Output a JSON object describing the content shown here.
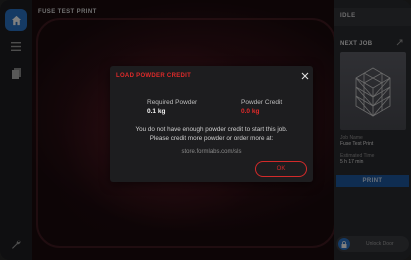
{
  "colors": {
    "accent": "#2a74c9",
    "error": "#e02a2a",
    "ok_border": "#d22a2a"
  },
  "sidebar": {
    "items": [
      {
        "icon": "home-icon",
        "active": true
      },
      {
        "icon": "menu-icon",
        "active": false
      },
      {
        "icon": "document-icon",
        "active": false
      },
      {
        "icon": "wrench-icon",
        "active": false
      }
    ]
  },
  "main": {
    "print_name": "FUSE TEST PRINT"
  },
  "right_panel": {
    "status": "IDLE",
    "next_job_label": "NEXT JOB",
    "job_name_label": "Job Name",
    "job_name_value": "Fuse Test Print",
    "est_time_label": "Estimated Time",
    "est_time_value": "5 h 17 min",
    "print_button": "PRINT",
    "unlock_label": "Unlock Door"
  },
  "dialog": {
    "title": "LOAD POWDER CREDIT",
    "required_label": "Required Powder",
    "required_value": "0.1 kg",
    "credit_label": "Powder Credit",
    "credit_value": "0.0 kg",
    "message_line1": "You do not have enough powder credit to start this job.",
    "message_line2": "Please credit more powder or order more at:",
    "url": "store.formlabs.com/sls",
    "ok_label": "OK"
  }
}
